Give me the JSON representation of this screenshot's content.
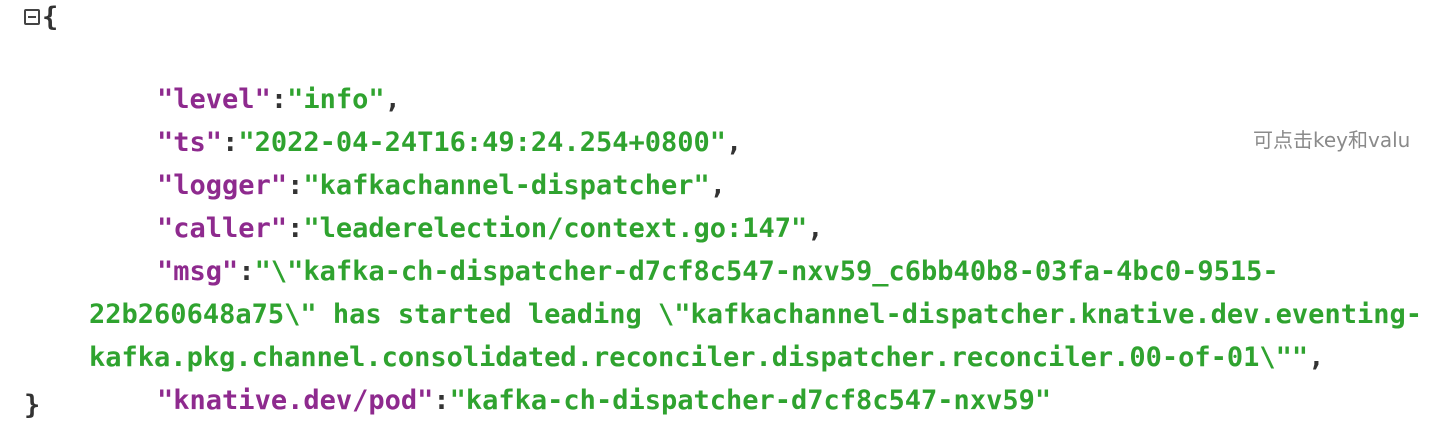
{
  "json": {
    "open_brace": "{",
    "close_brace": "}",
    "entries": [
      {
        "key": "\"level\"",
        "value": "\"info\"",
        "sep": ":",
        "comma": ","
      },
      {
        "key": "\"ts\"",
        "value": "\"2022-04-24T16:49:24.254+0800\"",
        "sep": ":",
        "comma": ","
      },
      {
        "key": "\"logger\"",
        "value": "\"kafkachannel-dispatcher\"",
        "sep": ":",
        "comma": ","
      },
      {
        "key": "\"caller\"",
        "value": "\"leaderelection/context.go:147\"",
        "sep": ":",
        "comma": ","
      },
      {
        "key": "\"msg\"",
        "sep": ":",
        "value_line1": "\"\\\"kafka-ch-dispatcher-d7cf8c547-nxv59_c6bb40b8-03fa-4bc0-9515-",
        "value_line2": "22b260648a75\\\" has started leading \\\"kafkachannel-dispatcher.knative.dev.eventing-",
        "value_line3": "kafka.pkg.channel.consolidated.reconciler.dispatcher.reconciler.00-of-01\\\"\"",
        "comma": ","
      },
      {
        "key": "\"knative.dev/pod\"",
        "value": "\"kafka-ch-dispatcher-d7cf8c547-nxv59\"",
        "sep": ":",
        "comma": ""
      }
    ]
  },
  "hint": "可点击key和valu"
}
